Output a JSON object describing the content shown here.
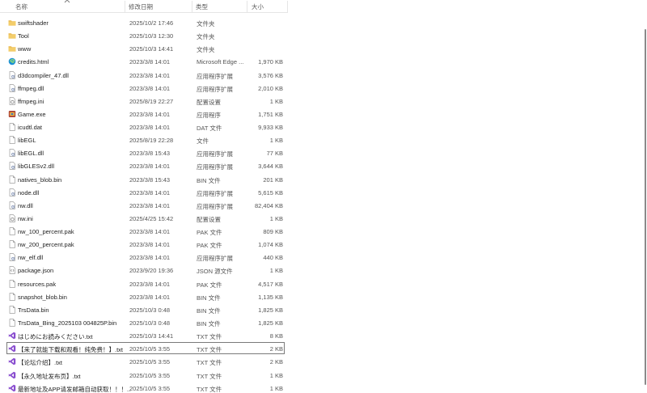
{
  "header": {
    "name": "名称",
    "date": "修改日期",
    "type": "类型",
    "size": "大小"
  },
  "files": [
    {
      "name": "swiftshader",
      "date": "2025/10/2 17:46",
      "type": "文件夹",
      "size": "",
      "icon": "folder-icon"
    },
    {
      "name": "Tool",
      "date": "2025/10/3 12:30",
      "type": "文件夹",
      "size": "",
      "icon": "folder-icon"
    },
    {
      "name": "www",
      "date": "2025/10/3 14:41",
      "type": "文件夹",
      "size": "",
      "icon": "folder-icon"
    },
    {
      "name": "credits.html",
      "date": "2023/3/8 14:01",
      "type": "Microsoft Edge ...",
      "size": "1,970 KB",
      "icon": "edge-icon"
    },
    {
      "name": "d3dcompiler_47.dll",
      "date": "2023/3/8 14:01",
      "type": "应用程序扩展",
      "size": "3,576 KB",
      "icon": "dll-icon"
    },
    {
      "name": "ffmpeg.dll",
      "date": "2023/3/8 14:01",
      "type": "应用程序扩展",
      "size": "2,010 KB",
      "icon": "dll-icon"
    },
    {
      "name": "ffmpeg.ini",
      "date": "2025/8/19 22:27",
      "type": "配置设置",
      "size": "1 KB",
      "icon": "ini-icon"
    },
    {
      "name": "Game.exe",
      "date": "2023/3/8 14:01",
      "type": "应用程序",
      "size": "1,751 KB",
      "icon": "exe-icon"
    },
    {
      "name": "icudtl.dat",
      "date": "2023/3/8 14:01",
      "type": "DAT 文件",
      "size": "9,933 KB",
      "icon": "file-icon"
    },
    {
      "name": "libEGL",
      "date": "2025/8/19 22:28",
      "type": "文件",
      "size": "1 KB",
      "icon": "file-icon"
    },
    {
      "name": "libEGL.dll",
      "date": "2023/3/8 15:43",
      "type": "应用程序扩展",
      "size": "77 KB",
      "icon": "dll-icon"
    },
    {
      "name": "libGLESv2.dll",
      "date": "2023/3/8 14:01",
      "type": "应用程序扩展",
      "size": "3,644 KB",
      "icon": "dll-icon"
    },
    {
      "name": "natives_blob.bin",
      "date": "2023/3/8 15:43",
      "type": "BIN 文件",
      "size": "201 KB",
      "icon": "file-icon"
    },
    {
      "name": "node.dll",
      "date": "2023/3/8 14:01",
      "type": "应用程序扩展",
      "size": "5,615 KB",
      "icon": "dll-icon"
    },
    {
      "name": "nw.dll",
      "date": "2023/3/8 14:01",
      "type": "应用程序扩展",
      "size": "82,404 KB",
      "icon": "dll-icon"
    },
    {
      "name": "nw.ini",
      "date": "2025/4/25 15:42",
      "type": "配置设置",
      "size": "1 KB",
      "icon": "ini-icon"
    },
    {
      "name": "nw_100_percent.pak",
      "date": "2023/3/8 14:01",
      "type": "PAK 文件",
      "size": "809 KB",
      "icon": "file-icon"
    },
    {
      "name": "nw_200_percent.pak",
      "date": "2023/3/8 14:01",
      "type": "PAK 文件",
      "size": "1,074 KB",
      "icon": "file-icon"
    },
    {
      "name": "nw_elf.dll",
      "date": "2023/3/8 14:01",
      "type": "应用程序扩展",
      "size": "440 KB",
      "icon": "dll-icon"
    },
    {
      "name": "package.json",
      "date": "2023/9/20 19:36",
      "type": "JSON 源文件",
      "size": "1 KB",
      "icon": "json-icon"
    },
    {
      "name": "resources.pak",
      "date": "2023/3/8 14:01",
      "type": "PAK 文件",
      "size": "4,517 KB",
      "icon": "file-icon"
    },
    {
      "name": "snapshot_blob.bin",
      "date": "2023/3/8 14:01",
      "type": "BIN 文件",
      "size": "1,135 KB",
      "icon": "file-icon"
    },
    {
      "name": "TrsData.bin",
      "date": "2025/10/3 0:48",
      "type": "BIN 文件",
      "size": "1,825 KB",
      "icon": "file-icon"
    },
    {
      "name": "TrsData_Bing_2025103 004825P.bin",
      "date": "2025/10/3 0:48",
      "type": "BIN 文件",
      "size": "1,825 KB",
      "icon": "file-icon"
    },
    {
      "name": "はじめにお読みください.txt",
      "date": "2025/10/3 14:41",
      "type": "TXT 文件",
      "size": "8 KB",
      "icon": "vs-text-icon"
    },
    {
      "name": "【来了就能下载和观看！纯免费！】.txt",
      "date": "2025/10/5 3:55",
      "type": "TXT 文件",
      "size": "2 KB",
      "icon": "vs-text-icon",
      "selected": true
    },
    {
      "name": "【论坛介绍】.txt",
      "date": "2025/10/5 3:55",
      "type": "TXT 文件",
      "size": "2 KB",
      "icon": "vs-text-icon"
    },
    {
      "name": "【永久地址发布页】.txt",
      "date": "2025/10/5 3:55",
      "type": "TXT 文件",
      "size": "1 KB",
      "icon": "vs-text-icon"
    },
    {
      "name": "最新地址及APP请发邮箱自动获取！！！...",
      "date": "2025/10/5 3:55",
      "type": "TXT 文件",
      "size": "1 KB",
      "icon": "vs-text-icon"
    }
  ],
  "colors": {
    "folder": "#e8b64c",
    "edge": "#1a8fd6",
    "vs": "#8a4fcf",
    "exe": "#b04a3a",
    "selection_border": "#7a7a7a"
  }
}
